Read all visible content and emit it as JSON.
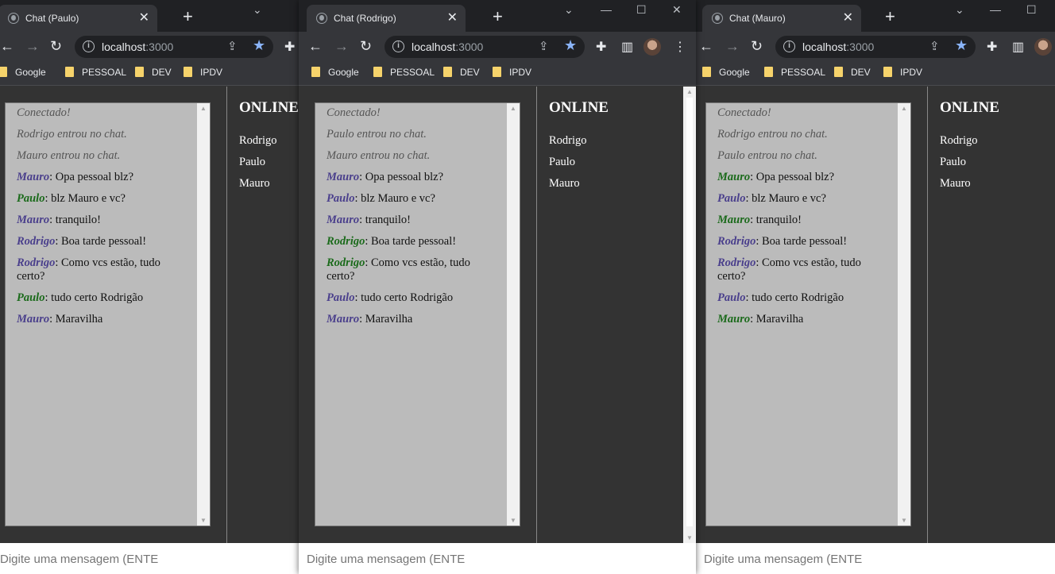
{
  "windows": [
    {
      "tab_title": "Chat (Paulo)",
      "url_host": "localhost",
      "url_port": ":3000",
      "bookmarks": [
        "Google",
        "PESSOAL",
        "DEV",
        "IPDV"
      ],
      "messages": [
        {
          "sys": "Conectado!"
        },
        {
          "sys": "Rodrigo entrou no chat."
        },
        {
          "sys": "Mauro entrou no chat."
        },
        {
          "user": "Mauro",
          "text": ": Opa pessoal blz?"
        },
        {
          "user": "Paulo",
          "text": ": blz Mauro e vc?"
        },
        {
          "user": "Mauro",
          "text": ": tranquilo!"
        },
        {
          "user": "Rodrigo",
          "text": ": Boa tarde pessoal!"
        },
        {
          "user": "Rodrigo",
          "text": ": Como vcs estão, tudo certo?"
        },
        {
          "user": "Paulo",
          "text": ": tudo certo Rodrigão"
        },
        {
          "user": "Mauro",
          "text": ": Maravilha"
        }
      ],
      "online_title": "ONLINE",
      "online_users": [
        "Rodrigo",
        "Paulo",
        "Mauro"
      ],
      "input_placeholder": "Digite uma mensagem (ENTER)"
    },
    {
      "tab_title": "Chat (Rodrigo)",
      "url_host": "localhost",
      "url_port": ":3000",
      "bookmarks": [
        "Google",
        "PESSOAL",
        "DEV",
        "IPDV"
      ],
      "messages": [
        {
          "sys": "Conectado!"
        },
        {
          "sys": "Paulo entrou no chat."
        },
        {
          "sys": "Mauro entrou no chat."
        },
        {
          "user": "Mauro",
          "text": ": Opa pessoal blz?"
        },
        {
          "user": "Paulo",
          "text": ": blz Mauro e vc?"
        },
        {
          "user": "Mauro",
          "text": ": tranquilo!"
        },
        {
          "user": "Rodrigo",
          "text": ": Boa tarde pessoal!"
        },
        {
          "user": "Rodrigo",
          "text": ": Como vcs estão, tudo certo?"
        },
        {
          "user": "Paulo",
          "text": ": tudo certo Rodrigão"
        },
        {
          "user": "Mauro",
          "text": ": Maravilha"
        }
      ],
      "online_title": "ONLINE",
      "online_users": [
        "Rodrigo",
        "Paulo",
        "Mauro"
      ],
      "input_placeholder": "Digite uma mensagem (ENTER)"
    },
    {
      "tab_title": "Chat (Mauro)",
      "url_host": "localhost",
      "url_port": ":3000",
      "bookmarks": [
        "Google",
        "PESSOAL",
        "DEV",
        "IPDV"
      ],
      "messages": [
        {
          "sys": "Conectado!"
        },
        {
          "sys": "Rodrigo entrou no chat."
        },
        {
          "sys": "Paulo entrou no chat."
        },
        {
          "user": "Mauro",
          "text": ": Opa pessoal blz?"
        },
        {
          "user": "Paulo",
          "text": ": blz Mauro e vc?"
        },
        {
          "user": "Mauro",
          "text": ": tranquilo!"
        },
        {
          "user": "Rodrigo",
          "text": ": Boa tarde pessoal!"
        },
        {
          "user": "Rodrigo",
          "text": ": Como vcs estão, tudo certo?"
        },
        {
          "user": "Paulo",
          "text": ": tudo certo Rodrigão"
        },
        {
          "user": "Mauro",
          "text": ": Maravilha"
        }
      ],
      "online_title": "ONLINE",
      "online_users": [
        "Rodrigo",
        "Paulo",
        "Mauro"
      ],
      "input_placeholder": "Digite uma mensagem (ENTER)"
    }
  ],
  "colors": {
    "self_user": "#1a6a1a",
    "other_user": "#4a3f8c",
    "star": "#8ab4f8",
    "folder": "#f6d36b"
  },
  "icons": {
    "tab": "globe-icon",
    "close": "close-icon",
    "new_tab": "plus-icon",
    "back": "back-arrow-icon",
    "forward": "forward-arrow-icon",
    "reload": "reload-icon",
    "info": "info-icon",
    "share": "share-icon",
    "star": "star-icon",
    "extensions": "puzzle-icon",
    "sidepanel": "side-panel-icon",
    "menu": "kebab-menu-icon",
    "folder": "folder-icon"
  }
}
